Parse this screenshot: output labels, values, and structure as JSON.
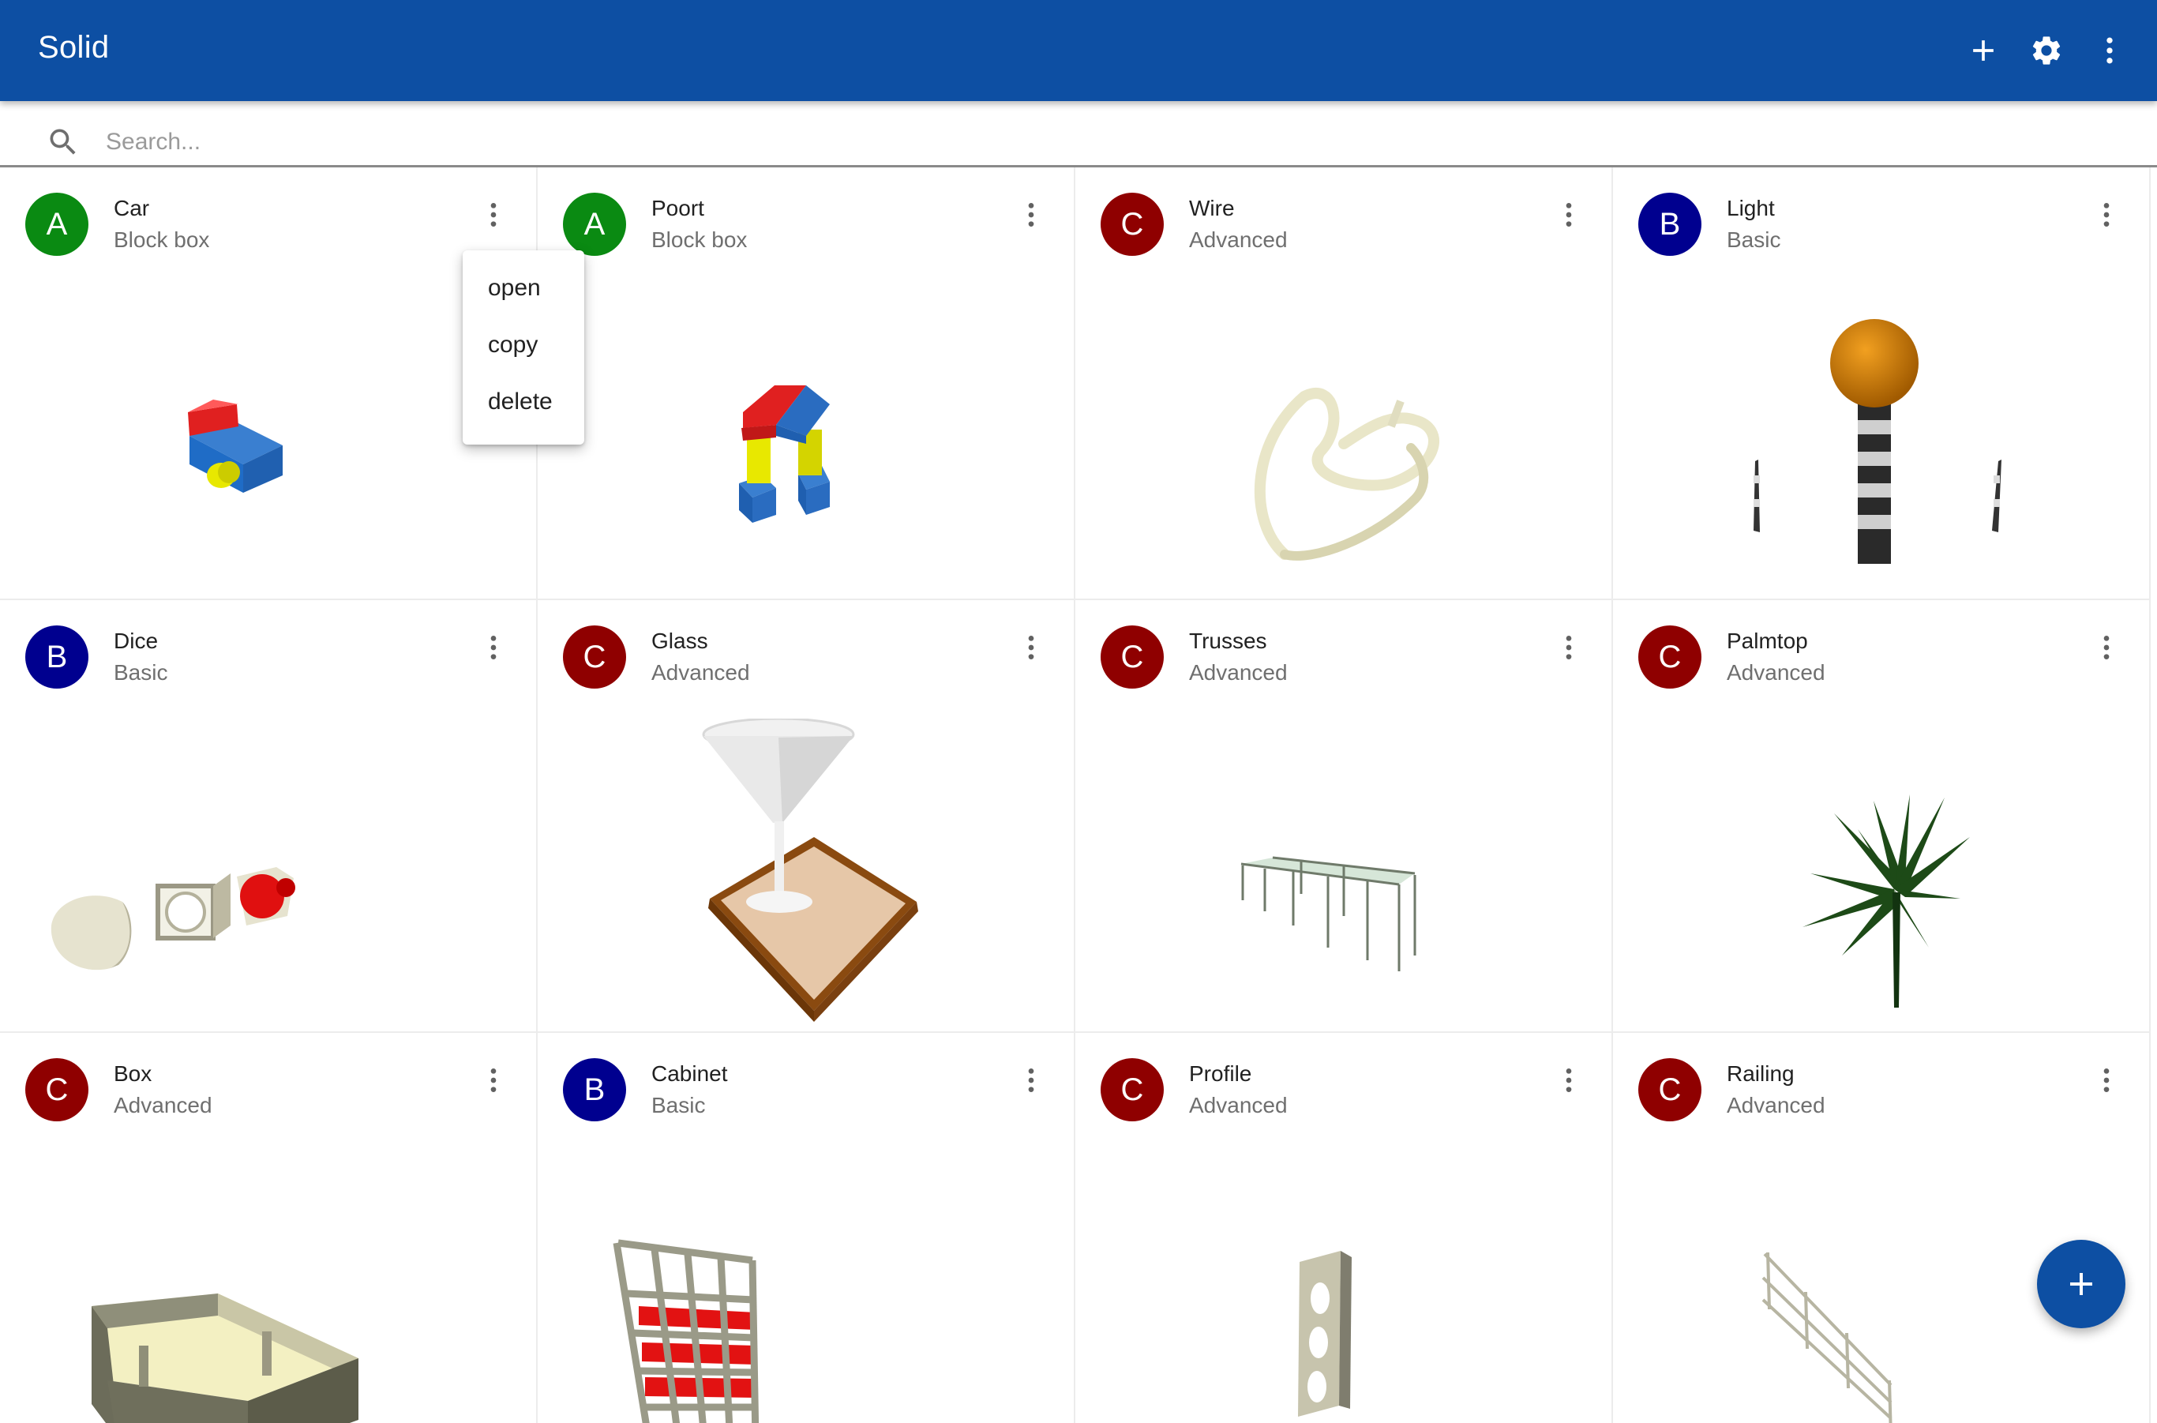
{
  "app": {
    "title": "Solid"
  },
  "toolbar": {
    "add_icon": "plus-icon",
    "settings_icon": "gear-icon",
    "more_icon": "more-vert-icon"
  },
  "search": {
    "placeholder": "Search...",
    "value": ""
  },
  "menu": {
    "items": [
      "open",
      "copy",
      "delete"
    ]
  },
  "fab": {
    "icon": "plus-icon"
  },
  "colors": {
    "primary": "#0d4fa3",
    "level_a": "#0a8a12",
    "level_b": "#00008f",
    "level_c": "#8f0000"
  },
  "cards": [
    {
      "avatar": "A",
      "title": "Car",
      "subtitle": "Block box",
      "thumbnail": "block car model"
    },
    {
      "avatar": "A",
      "title": "Poort",
      "subtitle": "Block box",
      "thumbnail": "block gate model"
    },
    {
      "avatar": "C",
      "title": "Wire",
      "subtitle": "Advanced",
      "thumbnail": "wire loop model"
    },
    {
      "avatar": "B",
      "title": "Light",
      "subtitle": "Basic",
      "thumbnail": "light post model"
    },
    {
      "avatar": "B",
      "title": "Dice",
      "subtitle": "Basic",
      "thumbnail": "dice model"
    },
    {
      "avatar": "C",
      "title": "Glass",
      "subtitle": "Advanced",
      "thumbnail": "glass model"
    },
    {
      "avatar": "C",
      "title": "Trusses",
      "subtitle": "Advanced",
      "thumbnail": "trusses model"
    },
    {
      "avatar": "C",
      "title": "Palmtop",
      "subtitle": "Advanced",
      "thumbnail": "palm model"
    },
    {
      "avatar": "C",
      "title": "Box",
      "subtitle": "Advanced",
      "thumbnail": "box model"
    },
    {
      "avatar": "B",
      "title": "Cabinet",
      "subtitle": "Basic",
      "thumbnail": "cabinet model"
    },
    {
      "avatar": "C",
      "title": "Profile",
      "subtitle": "Advanced",
      "thumbnail": "profile model"
    },
    {
      "avatar": "C",
      "title": "Railing",
      "subtitle": "Advanced",
      "thumbnail": "railing model"
    }
  ]
}
